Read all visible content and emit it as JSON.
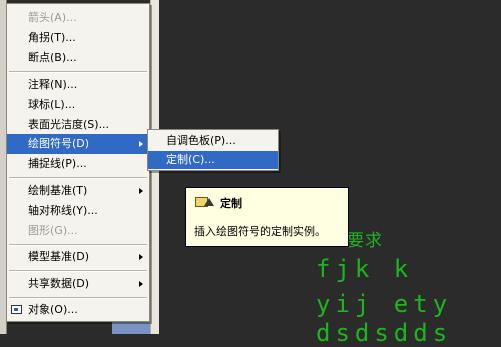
{
  "context_menu": {
    "items": [
      {
        "label": "箭头(A)...",
        "disabled": true
      },
      {
        "label": "角拐(T)...",
        "disabled": false
      },
      {
        "label": "断点(B)...",
        "disabled": false
      },
      {
        "label": "注释(N)...",
        "disabled": false
      },
      {
        "label": "球标(L)...",
        "disabled": false
      },
      {
        "label": "表面光洁度(S)...",
        "disabled": false
      },
      {
        "label": "绘图符号(D)",
        "disabled": false,
        "submenu": true,
        "selected": true
      },
      {
        "label": "捕捉线(P)...",
        "disabled": false
      },
      {
        "label": "绘制基准(T)",
        "disabled": false,
        "submenu": true
      },
      {
        "label": "轴对称线(Y)...",
        "disabled": false
      },
      {
        "label": "图形(G)...",
        "disabled": true
      },
      {
        "label": "模型基准(D)",
        "disabled": false,
        "submenu": true
      },
      {
        "label": "共享数据(D)",
        "disabled": false,
        "submenu": true
      },
      {
        "label": "对象(O)...",
        "disabled": false,
        "icon": "object-icon"
      }
    ]
  },
  "submenu": {
    "items": [
      {
        "label": "自调色板(P)...",
        "selected": false
      },
      {
        "label": "定制(C)...",
        "selected": true
      }
    ]
  },
  "tooltip": {
    "title": "定制",
    "description": "插入绘图符号的定制实例。",
    "icon": "custom-symbol-icon"
  },
  "canvas_text": {
    "line1": "要求",
    "line2": "fjk k",
    "line3": "yij ety",
    "line4": "dsdsdds"
  },
  "colors": {
    "canvas_background": "#2b2b2b",
    "canvas_text": "#1db51d",
    "highlight": "#316ac5",
    "menu_background": "#f4f3ee",
    "tooltip_background": "#ffffe1"
  }
}
